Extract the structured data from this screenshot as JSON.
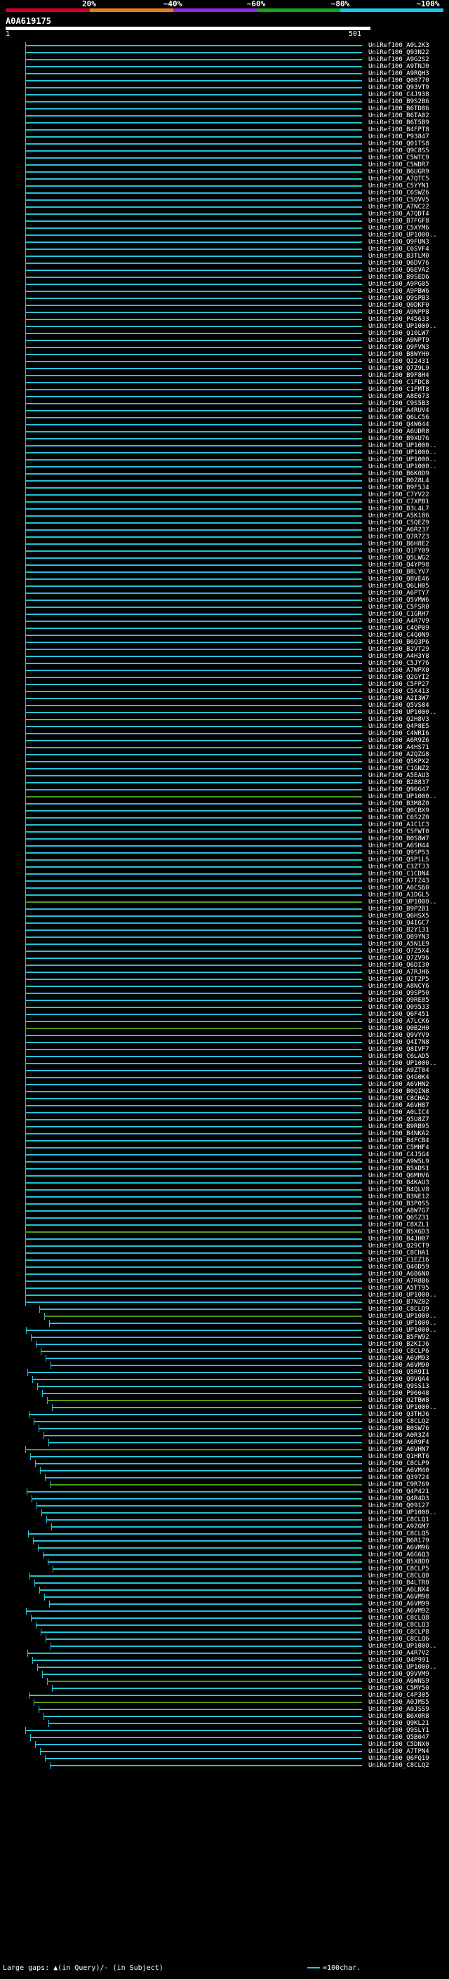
{
  "header": {
    "scale_labels": [
      "20%",
      "~40%",
      "~60%",
      "~80%",
      "~100%"
    ],
    "scale_colors": [
      "#d4002a",
      "#e08020",
      "#8a2be2",
      "#17a317",
      "#1ec8e6"
    ],
    "query_id": "A0A619175",
    "start_pos": "1",
    "end_pos": "501"
  },
  "colors": {
    "cyan": "#22c3d8",
    "green": "#4c9a1a",
    "yellow": "#d8d800",
    "tick": "#22c3d8"
  },
  "hits": [
    "UniRef100_A0L2K3",
    "UniRef100_Q93N22",
    "UniRef100_A9G2S2",
    "UniRef100_A9TNJ0",
    "UniRef100_A9RQH3",
    "UniRef100_Q08770",
    "UniRef100_Q93VT9",
    "UniRef100_C4J938",
    "UniRef100_B9S2B6",
    "UniRef100_B6TD86",
    "UniRef100_B6TA02",
    "UniRef100_B6T5B9",
    "UniRef100_B4FPT8",
    "UniRef100_P93847",
    "UniRef100_Q01TS8",
    "UniRef100_Q9C8S5",
    "UniRef100_C5WTC9",
    "UniRef100_C5WDR7",
    "UniRef100_B6UGR9",
    "UniRef100_A7QTC5",
    "UniRef100_C5YYN1",
    "UniRef100_C6SWZ6",
    "UniRef100_C5QVV5",
    "UniRef100_A7NC22",
    "UniRef100_A7QDT4",
    "UniRef100_B7FGF8",
    "UniRef100_C5XYM6",
    "UniRef100_UP1000..",
    "UniRef100_Q9FUN3",
    "UniRef100_C6SVF4",
    "UniRef100_B3TLM0",
    "UniRef100_Q6DV76",
    "UniRef100_Q6EVA2",
    "UniRef100_B9SED6",
    "UniRef100_A9PG05",
    "UniRef100_A9PBW6",
    "UniRef100_Q9SPB3",
    "UniRef100_Q0DKF0",
    "UniRef100_A9NPP8",
    "UniRef100_P45633",
    "UniRef100_UP1000..",
    "UniRef100_Q10LW7",
    "UniRef100_A9NPT9",
    "UniRef100_Q9FVN3",
    "UniRef100_B8WYH0",
    "UniRef100_Q22431",
    "UniRef100_Q7Z9L9",
    "UniRef100_B9F8H4",
    "UniRef100_C1FDC8",
    "UniRef100_C1FMT8",
    "UniRef100_A8E673",
    "UniRef100_C9S5B3",
    "UniRef100_A4RUV4",
    "UniRef100_Q6LC56",
    "UniRef100_Q4W644",
    "UniRef100_A6UDR8",
    "UniRef100_B9XU76",
    "UniRef100_UP1000..",
    "UniRef100_UP1000..",
    "UniRef100_UP1000..",
    "UniRef100_UP1000..",
    "UniRef100_B6K0D9",
    "UniRef100_B0Z8L4",
    "UniRef100_B9F5J4",
    "UniRef100_C7YV22",
    "UniRef100_C7XPB1",
    "UniRef100_B3L4L7",
    "UniRef100_A5K186",
    "UniRef100_C5QEZ9",
    "UniRef100_A6R237",
    "UniRef100_Q7R7Z3",
    "UniRef100_B6H8E2",
    "UniRef100_Q1FY09",
    "UniRef100_Q5LWG2",
    "UniRef100_Q4YP98",
    "UniRef100_B8LYV7",
    "UniRef100_Q8VE46",
    "UniRef100_Q6LH05",
    "UniRef100_A6PTY7",
    "UniRef100_Q5VMW6",
    "UniRef100_C5FSR0",
    "UniRef100_C1GRH7",
    "UniRef100_A4R7V9",
    "UniRef100_C4QP09",
    "UniRef100_C4Q0N9",
    "UniRef100_B6Q3P6",
    "UniRef100_B2VT29",
    "UniRef100_A4H3Y8",
    "UniRef100_C5JY76",
    "UniRef100_A7WPX0",
    "UniRef100_Q2GYI2",
    "UniRef100_C5FP27",
    "UniRef100_C5X413",
    "UniRef100_A2I3W7",
    "UniRef100_Q5VS84",
    "UniRef100_UP1000..",
    "UniRef100_Q2H8V3",
    "UniRef100_Q4P8E5",
    "UniRef100_C4WRI6",
    "UniRef100_A6R9Z6",
    "UniRef100_A4HS71",
    "UniRef100_A2QZG8",
    "UniRef100_Q5KPX2",
    "UniRef100_C1GNZ2",
    "UniRef100_A5EAU3",
    "UniRef100_B2B837",
    "UniRef100_Q96G47",
    "UniRef100_UP1000..",
    "UniRef100_B3M8Z0",
    "UniRef100_Q0CBX9",
    "UniRef100_C6S2Z0",
    "UniRef100_A1C1C3",
    "UniRef100_C5FWT0",
    "UniRef100_B0S8W7",
    "UniRef100_A6SH44",
    "UniRef100_Q9SP53",
    "UniRef100_Q5P1L5",
    "UniRef100_C3ZTJ3",
    "UniRef100_C1CDN4",
    "UniRef100_A7TZ43",
    "UniRef100_A6CS60",
    "UniRef100_A1DGL5",
    "UniRef100_UP1000..",
    "UniRef100_B9P2B1",
    "UniRef100_Q6HSX5",
    "UniRef100_Q4IGC7",
    "UniRef100_B2Y131",
    "UniRef100_Q89YN3",
    "UniRef100_A5N1E9",
    "UniRef100_Q7Z5X4",
    "UniRef100_Q7ZV96",
    "UniRef100_Q6DI30",
    "UniRef100_A7RJH6",
    "UniRef100_Q2T2P5",
    "UniRef100_A8NCY6",
    "UniRef100_Q9SP50",
    "UniRef100_Q9RE85",
    "UniRef100_Q09533",
    "UniRef100_Q6F451",
    "UniRef100_A7LCK6",
    "UniRef100_Q0B2H0",
    "UniRef100_Q9VYV9",
    "UniRef100_Q4I7N8",
    "UniRef100_Q8IVF7",
    "UniRef100_C6LAD5",
    "UniRef100_UP1000..",
    "UniRef100_A9ZT84",
    "UniRef100_Q4G0K4",
    "UniRef100_A6VHN2",
    "UniRef100_B0QIN8",
    "UniRef100_C8CHA2",
    "UniRef100_A6VH87",
    "UniRef100_A0LIC4",
    "UniRef100_Q5U8Z7",
    "UniRef100_B9RB95",
    "UniRef100_B4NKA2",
    "UniRef100_B4FCB4",
    "UniRef100_C5MHF4",
    "UniRef100_C4J5G4",
    "UniRef100_A9W5L9",
    "UniRef100_B5XDS1",
    "UniRef100_Q6MHV6",
    "UniRef100_B4KAU3",
    "UniRef100_B4QLV8",
    "UniRef100_B3NE12",
    "UniRef100_B3P0S5",
    "UniRef100_A8W7G7",
    "UniRef100_Q6SZ31",
    "UniRef100_C8XZL1",
    "UniRef100_B5X6D3",
    "UniRef100_B4JH07",
    "UniRef100_Q29CT9",
    "UniRef100_C8CHA1",
    "UniRef100_C1EZ16",
    "UniRef100_Q40D59",
    "UniRef100_A6B6N0",
    "UniRef100_A7R8B6",
    "UniRef100_A5TT95",
    "UniRef100_UP1000..",
    "UniRef100_B7NZ02",
    "UniRef100_C8CLQ9",
    "UniRef100_UP1000..",
    "UniRef100_UP1000..",
    "UniRef100_UP1000..",
    "UniRef100_B5FW92",
    "UniRef100_B2KIJ6",
    "UniRef100_C8CLP6",
    "UniRef100_A6VM93",
    "UniRef100_A6VM90",
    "UniRef100_Q5R9I1",
    "UniRef100_Q9VQA4",
    "UniRef100_Q9SS13",
    "UniRef100_P96048",
    "UniRef100_Q2TBW8",
    "UniRef100_UP1000..",
    "UniRef100_Q3THJ6",
    "UniRef100_C8CLQ2",
    "UniRef100_B0SW76",
    "UniRef100_A0R3Z4",
    "UniRef100_A6R9F4",
    "UniRef100_A6VHN7",
    "UniRef100_Q1HRT6",
    "UniRef100_C8CLP9",
    "UniRef100_A6VM40",
    "UniRef100_Q39724",
    "UniRef100_C9R769",
    "UniRef100_Q4P421",
    "UniRef100_Q4R4D3",
    "UniRef100_Q09127",
    "UniRef100_UP1000..",
    "UniRef100_C8CLQ1",
    "UniRef100_A9ZGM7",
    "UniRef100_C8CLQ5",
    "UniRef100_B6R179",
    "UniRef100_A6VM96",
    "UniRef100_A6G6Q3",
    "UniRef100_B5X8D0",
    "UniRef100_C8CLP5",
    "UniRef100_C8CLQ0",
    "UniRef100_B4LTR0",
    "UniRef100_A6LNX4",
    "UniRef100_A6VM98",
    "UniRef100_A6VM99",
    "UniRef100_A6VM92",
    "UniRef100_C8CLQ8",
    "UniRef100_C8CLQ3",
    "UniRef100_C8CLP8",
    "UniRef100_C8CLQ6",
    "UniRef100_UP1000..",
    "UniRef100_A4R7V2",
    "UniRef100_Q4P991",
    "UniRef100_UP1000..",
    "UniRef100_Q9VVM9",
    "UniRef100_A6WNS9",
    "UniRef100_C5MY50",
    "UniRef100_C4P305",
    "UniRef100_A0JMS5",
    "UniRef100_A0JSS9",
    "UniRef100_B6X0R8",
    "UniRef100_Q9KL21",
    "UniRef100_Q9SLY1",
    "UniRef100_Q5B047",
    "UniRef100_C5DNX0",
    "UniRef100_A7TPN4",
    "UniRef100_Q6FQ19",
    "UniRef100_C8CLQ2"
  ],
  "legend": {
    "text": "Large gaps: ▲(in Query)/- (in Subject)",
    "scale": "=100char."
  }
}
